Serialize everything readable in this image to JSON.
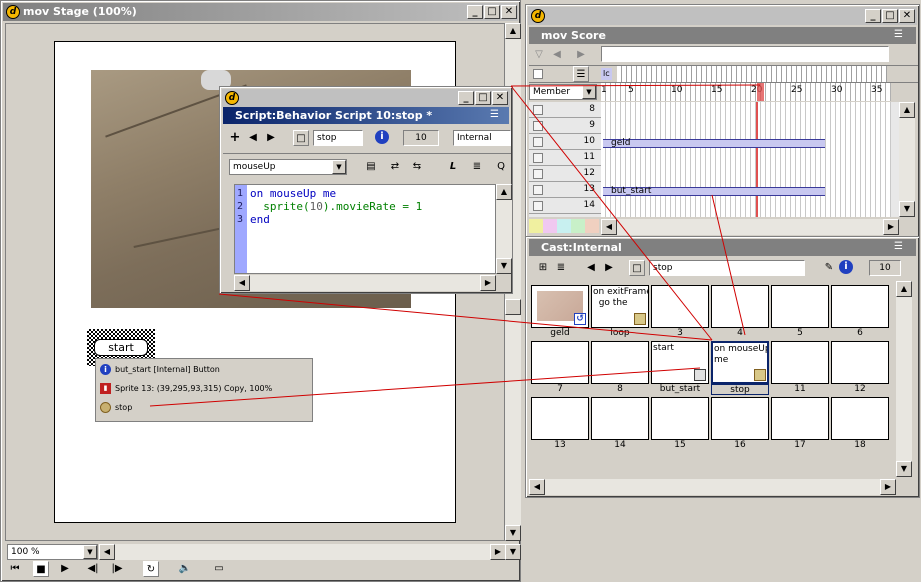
{
  "stage": {
    "title": "mov Stage (100%)",
    "zoom": "100 %",
    "sprite_button_label": "start",
    "info_overlay": {
      "line1": "but_start [Internal] Button",
      "line2": "Sprite 13: (39,295,93,315) Copy, 100%",
      "line3": "stop"
    }
  },
  "script_window": {
    "title": "Script:Behavior Script 10:stop *",
    "name_field": "stop",
    "cast_number": "10",
    "cast_lib": "Internal",
    "handler_select": "mouseUp",
    "line_numbers": [
      "1",
      "2",
      "3"
    ],
    "code": {
      "line1_kw": "on mouseUp me",
      "line2_a": "  sprite(",
      "line2_num": "10",
      "line2_b": ").movieRate = ",
      "line2_val": "1",
      "line3_kw": "end"
    }
  },
  "score": {
    "title": "mov Score",
    "member_select": "Member",
    "frame_ticks": [
      "1",
      "5",
      "10",
      "15",
      "20",
      "25",
      "30",
      "35"
    ],
    "channels": [
      "8",
      "9",
      "10",
      "11",
      "12",
      "13",
      "14"
    ],
    "sprites": [
      {
        "channel": "10",
        "label": "geld"
      },
      {
        "channel": "13",
        "label": "but_start"
      }
    ],
    "marker_text": "lc"
  },
  "cast": {
    "title": "Cast:Internal",
    "name_field": "stop",
    "cast_number": "10",
    "members": [
      {
        "num": "1",
        "label": "geld",
        "text": ""
      },
      {
        "num": "2",
        "label": "loop",
        "text": "on exitFrame me\n  go the"
      },
      {
        "num": "3",
        "label": "3",
        "text": ""
      },
      {
        "num": "4",
        "label": "4",
        "text": ""
      },
      {
        "num": "5",
        "label": "5",
        "text": ""
      },
      {
        "num": "6",
        "label": "6",
        "text": ""
      },
      {
        "num": "7",
        "label": "7",
        "text": ""
      },
      {
        "num": "8",
        "label": "8",
        "text": ""
      },
      {
        "num": "9",
        "label": "but_start",
        "text": "start"
      },
      {
        "num": "10",
        "label": "stop",
        "text": "on mouseUp\nme"
      },
      {
        "num": "11",
        "label": "11",
        "text": ""
      },
      {
        "num": "12",
        "label": "12",
        "text": ""
      },
      {
        "num": "13",
        "label": "13",
        "text": ""
      },
      {
        "num": "14",
        "label": "14",
        "text": ""
      },
      {
        "num": "15",
        "label": "15",
        "text": ""
      },
      {
        "num": "16",
        "label": "16",
        "text": ""
      },
      {
        "num": "17",
        "label": "17",
        "text": ""
      },
      {
        "num": "18",
        "label": "18",
        "text": ""
      }
    ]
  },
  "colors": {
    "title_active": "#0a246a",
    "title_inactive": "#808080",
    "playhead": "#e05050",
    "line_number_bg": "#9fa8ff",
    "code_keyword": "#0000c0",
    "code_number": "#008000",
    "connector_line": "#d00000"
  },
  "icons": [
    "director-logo-icon",
    "minimize-icon",
    "maximize-icon",
    "close-icon",
    "play-icon",
    "stop-icon",
    "rewind-icon",
    "step-back-icon",
    "step-forward-icon",
    "loop-icon",
    "volume-icon",
    "info-icon",
    "script-icon",
    "behavior-icon",
    "bitmap-icon"
  ]
}
